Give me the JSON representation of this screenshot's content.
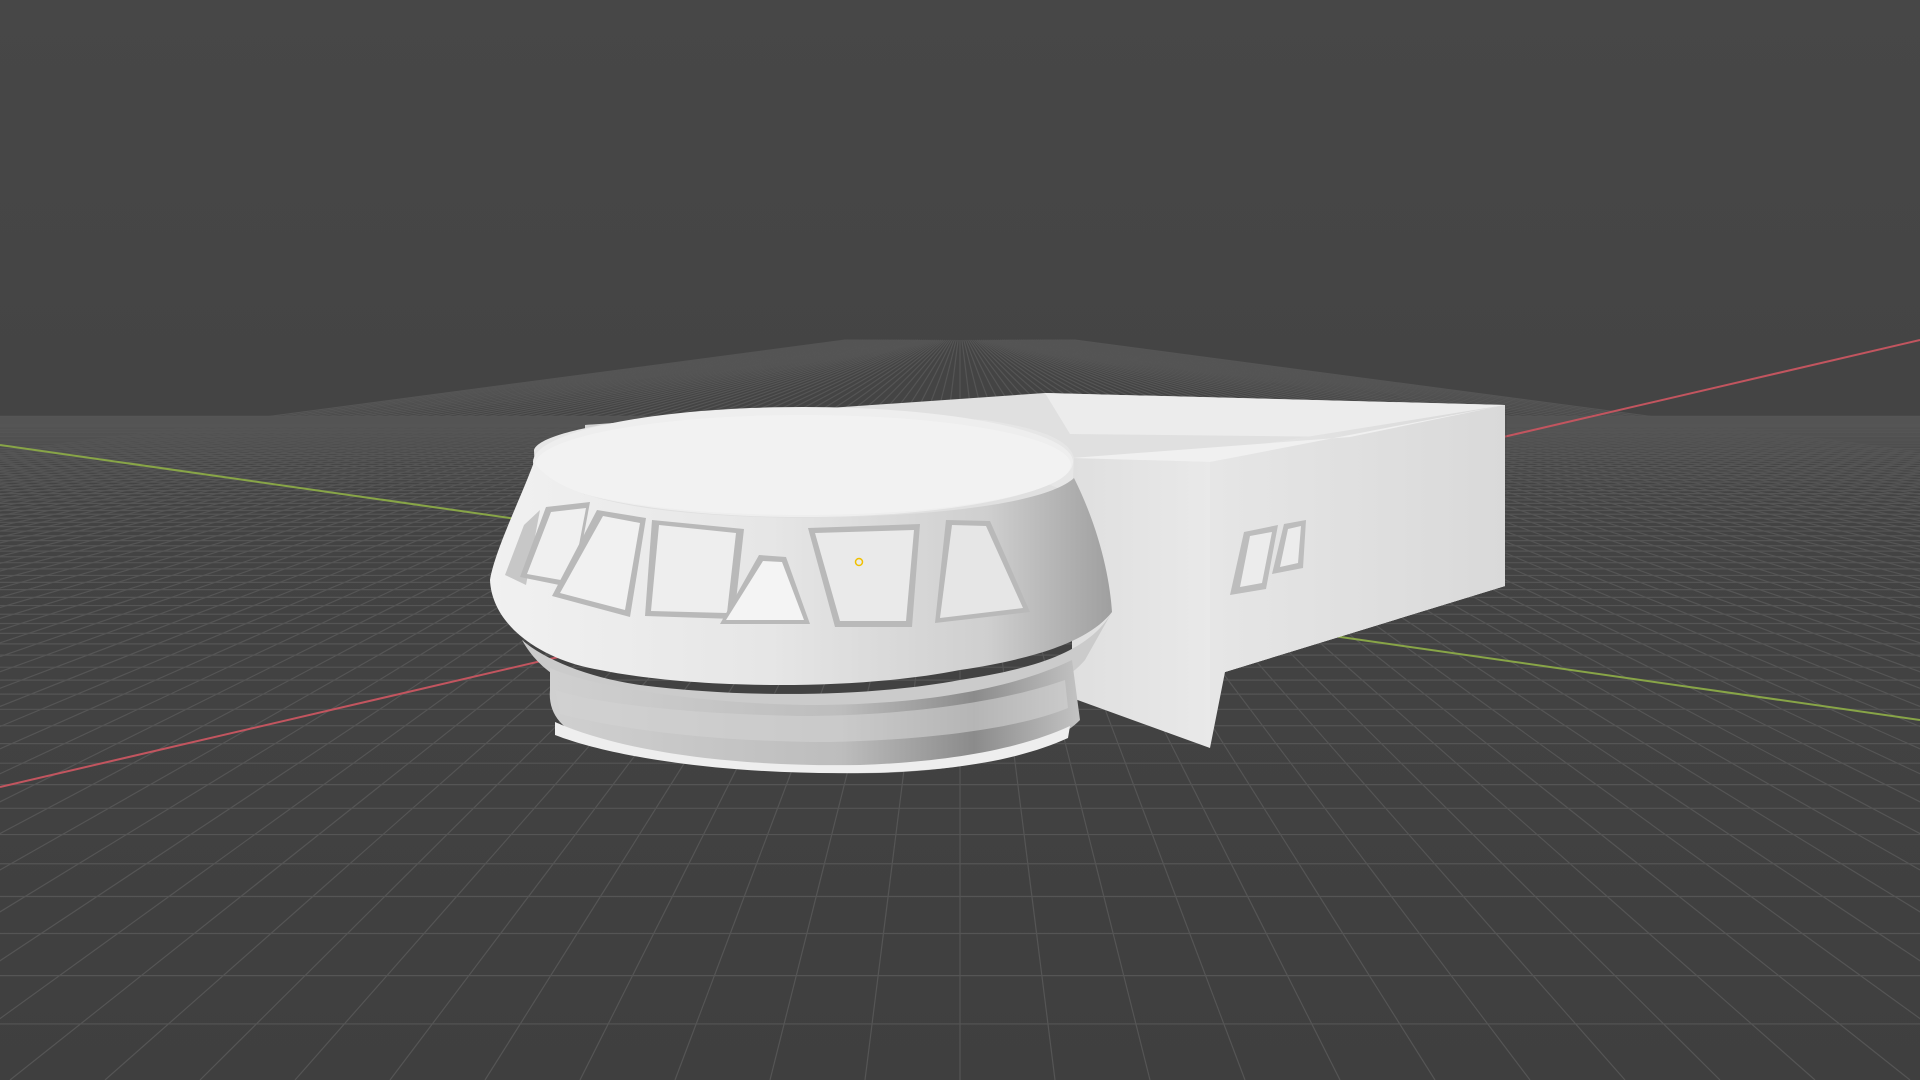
{
  "viewport": {
    "background": "#474747",
    "grid_color": "#555555",
    "x_axis_color": "#c2555f",
    "y_axis_color": "#88a547",
    "model_light": "#ececec",
    "model_mid": "#d6d6d6",
    "model_dark": "#a7a7a7",
    "origin_color": "#f0c000"
  },
  "scene": {
    "object_name": "",
    "icons": {
      "origin": "object-origin-dot"
    }
  }
}
